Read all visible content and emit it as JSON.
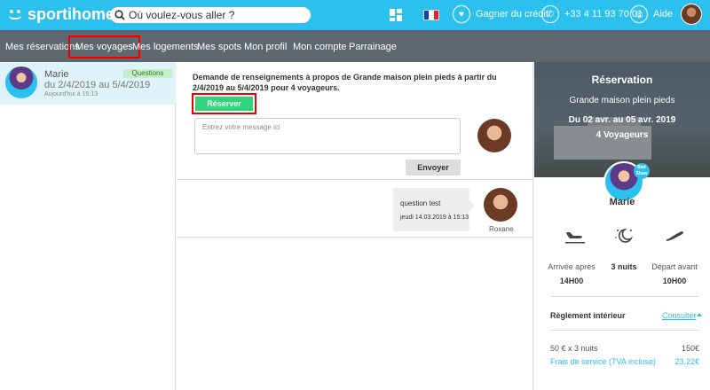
{
  "header": {
    "logo_text": "sportihome",
    "search": {
      "placeholder": "Où voulez-vous aller ?"
    },
    "credit_label": "Gagner du crédit",
    "phone_label": "+33 4 11 93 70 01",
    "help_label": "Aide",
    "accent_color": "#2cc0ee"
  },
  "nav": {
    "items": [
      {
        "label": "Mes réservations"
      },
      {
        "label": "Mes voyages",
        "active": true
      },
      {
        "label": "Mes logements"
      },
      {
        "label": "Mes spots"
      },
      {
        "label": "Mon profil"
      },
      {
        "label": "Mon compte"
      },
      {
        "label": "Parrainage"
      }
    ]
  },
  "conversations": [
    {
      "name": "Marie",
      "dates": "du 2/4/2019 au 5/4/2019",
      "time": "Aujourd'hui à 15:13",
      "badge": "Questions"
    }
  ],
  "thread": {
    "request_text": "Demande de renseignements à propos de Grande maison plein pieds à partir du 2/4/2019 au 5/4/2019 pour 4 voyageurs.",
    "reserve_label": "Réserver",
    "message_placeholder": "Entrez votre message ici",
    "send_label": "Envoyer",
    "messages": [
      {
        "text": "question test",
        "timestamp": "jeudi 14.03.2019 à 15:13",
        "author": "Roxane"
      }
    ]
  },
  "reservation": {
    "title": "Réservation",
    "property": "Grande maison plein pieds",
    "dates": "Du 02 avr. au 05 avr. 2019",
    "guests": "4 Voyageurs",
    "host_name": "Marie",
    "host_badge": "Bad Shaw",
    "arrival_label": "Arrivée après",
    "arrival_value": "14H00",
    "nights_label": "3 nuits",
    "departure_label": "Départ avant",
    "departure_value": "10H00",
    "rules_label": "Règlement intérieur",
    "rules_link": "Consulter",
    "price_line": "50 € x 3 nuits",
    "price_value": "150€",
    "fee_line": "Frais de service (TVA incluse)",
    "fee_value": "23,22€"
  }
}
